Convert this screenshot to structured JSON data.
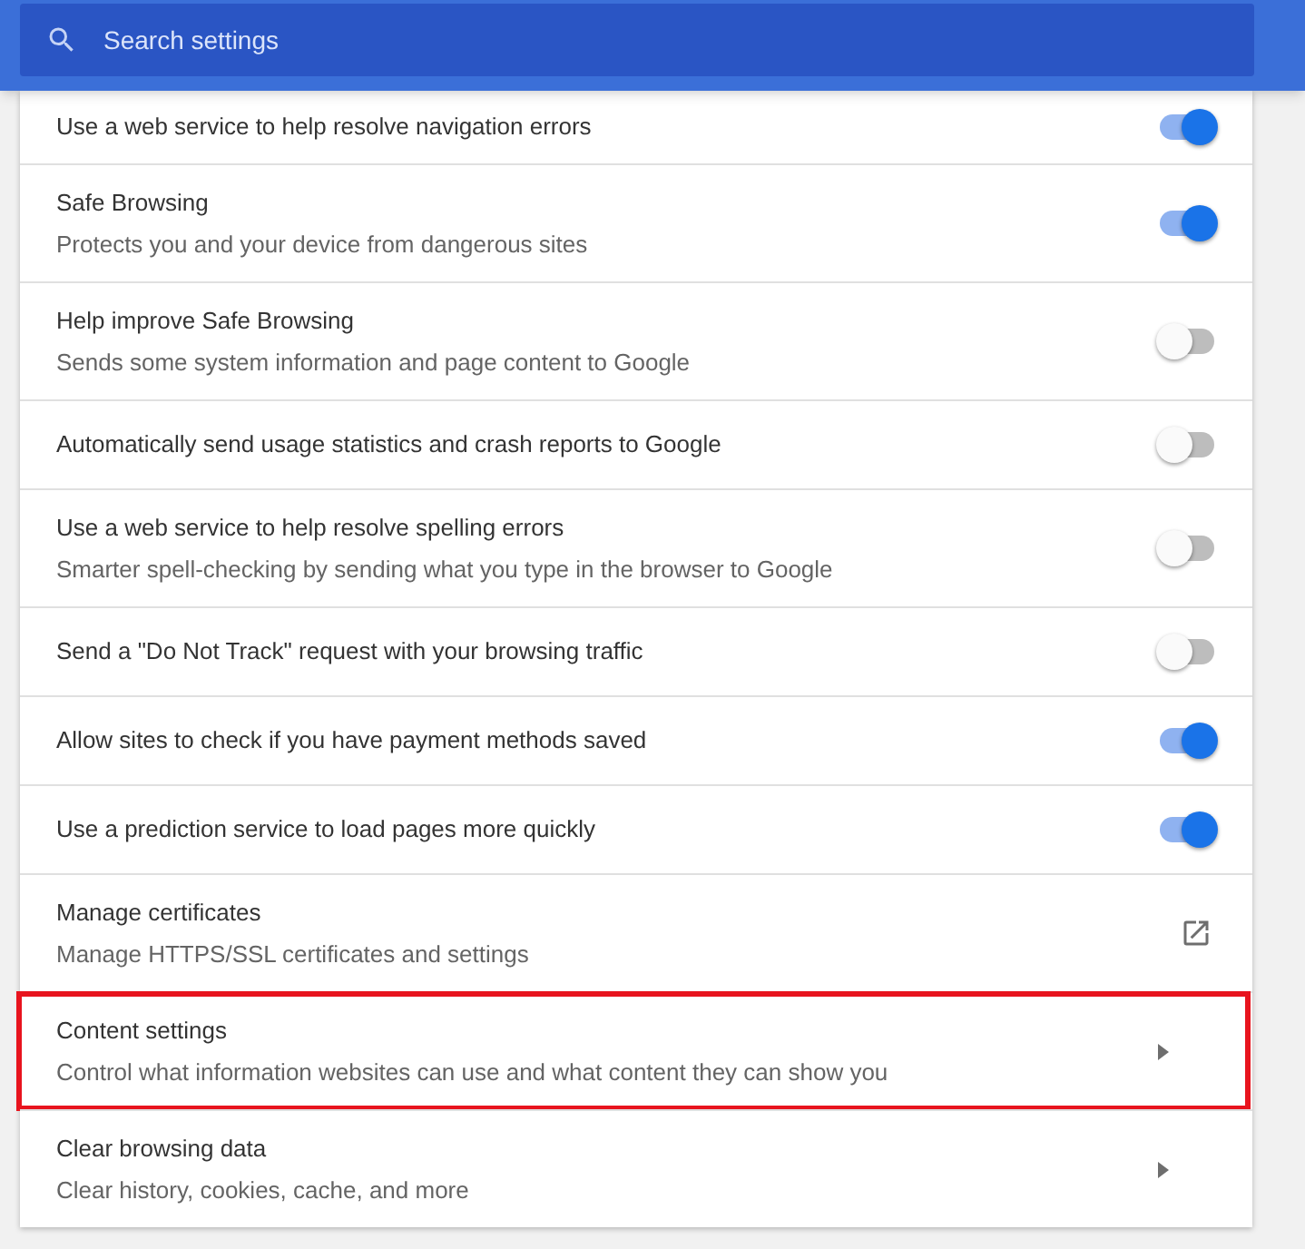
{
  "search": {
    "placeholder": "Search settings"
  },
  "rows": [
    {
      "kind": "toggle",
      "title": "Use a web service to help resolve navigation errors",
      "on": true,
      "highlighted": false
    },
    {
      "kind": "toggle",
      "title": "Safe Browsing",
      "subtitle": "Protects you and your device from dangerous sites",
      "on": true,
      "highlighted": false
    },
    {
      "kind": "toggle",
      "title": "Help improve Safe Browsing",
      "subtitle": "Sends some system information and page content to Google",
      "on": false,
      "highlighted": false
    },
    {
      "kind": "toggle",
      "title": "Automatically send usage statistics and crash reports to Google",
      "on": false,
      "highlighted": false
    },
    {
      "kind": "toggle",
      "title": "Use a web service to help resolve spelling errors",
      "subtitle": "Smarter spell-checking by sending what you type in the browser to Google",
      "on": false,
      "highlighted": false
    },
    {
      "kind": "toggle",
      "title": "Send a \"Do Not Track\" request with your browsing traffic",
      "on": false,
      "highlighted": false
    },
    {
      "kind": "toggle",
      "title": "Allow sites to check if you have payment methods saved",
      "on": true,
      "highlighted": false
    },
    {
      "kind": "toggle",
      "title": "Use a prediction service to load pages more quickly",
      "on": true,
      "highlighted": false
    },
    {
      "kind": "external",
      "title": "Manage certificates",
      "subtitle": "Manage HTTPS/SSL certificates and settings",
      "highlighted": false
    },
    {
      "kind": "arrow",
      "title": "Content settings",
      "subtitle": "Control what information websites can use and what content they can show you",
      "highlighted": true
    },
    {
      "kind": "arrow",
      "title": "Clear browsing data",
      "subtitle": "Clear history, cookies, cache, and more",
      "highlighted": false
    }
  ]
}
